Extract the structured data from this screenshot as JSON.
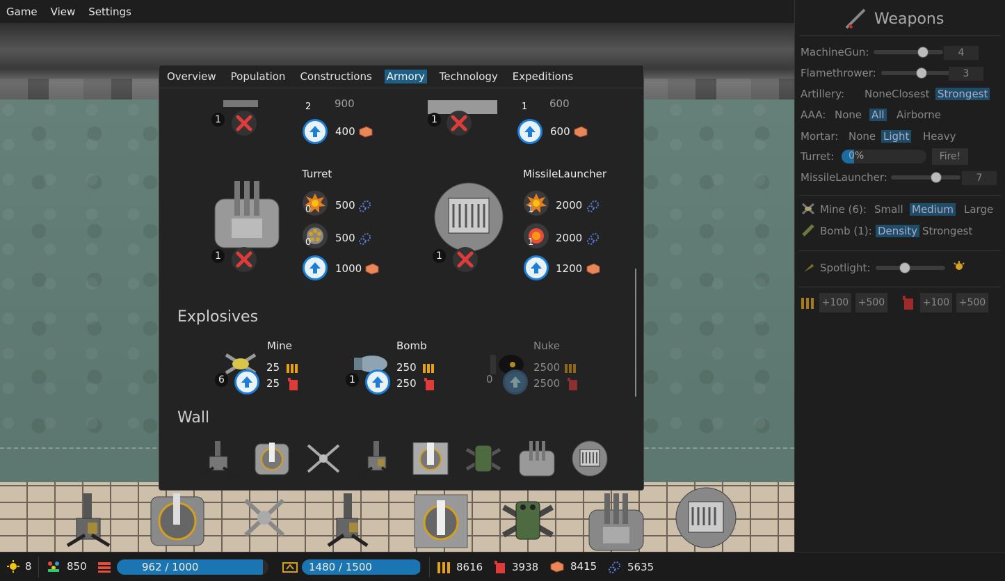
{
  "menu": [
    "Game",
    "View",
    "Settings"
  ],
  "tabs": [
    {
      "label": "Overview",
      "active": false
    },
    {
      "label": "Population",
      "active": false
    },
    {
      "label": "Constructions",
      "active": false
    },
    {
      "label": "Armory",
      "active": true
    },
    {
      "label": "Technology",
      "active": false
    },
    {
      "label": "Expeditions",
      "active": false
    }
  ],
  "armory": {
    "top_left": {
      "count": "1",
      "partial_count": "2",
      "partial_value": "900",
      "upgrade_cost": "400"
    },
    "top_right": {
      "count": "1",
      "partial_count": "1",
      "partial_value": "600",
      "upgrade_cost": "600"
    },
    "turret": {
      "name": "Turret",
      "count": "1",
      "stat1_level": "0",
      "stat1": "500",
      "stat2_level": "0",
      "stat2": "500",
      "upgrade_cost": "1000"
    },
    "missile": {
      "name": "MissileLauncher",
      "count": "1",
      "stat1_level": "1",
      "stat1": "2000",
      "stat2_level": "1",
      "stat2": "2000",
      "upgrade_cost": "1200"
    },
    "explosives_title": "Explosives",
    "mine": {
      "name": "Mine",
      "count": "6",
      "ammo": "25",
      "fuel": "25"
    },
    "bomb": {
      "name": "Bomb",
      "count": "1",
      "ammo": "250",
      "fuel": "250"
    },
    "nuke": {
      "name": "Nuke",
      "count": "0",
      "ammo": "2500",
      "fuel": "2500"
    },
    "wall_title": "Wall"
  },
  "sidebar": {
    "title": "Weapons",
    "machinegun": {
      "label": "MachineGun:",
      "value": "4",
      "level": 0.75
    },
    "flamethrower": {
      "label": "Flamethrower:",
      "value": "3",
      "level": 0.6
    },
    "artillery": {
      "label": "Artillery:",
      "options": [
        "None",
        "Closest",
        "Strongest"
      ],
      "selected": 2
    },
    "aaa": {
      "label": "AAA:",
      "options": [
        "None",
        "All",
        "Airborne"
      ],
      "selected": 1
    },
    "mortar": {
      "label": "Mortar:",
      "options": [
        "None",
        "Light",
        "Heavy"
      ],
      "selected": 1
    },
    "turret": {
      "label": "Turret:",
      "progress": "0%",
      "fire": "Fire!"
    },
    "missile": {
      "label": "MissileLauncher:",
      "value": "7",
      "level": 0.68
    },
    "mine": {
      "label": "Mine (6):",
      "options": [
        "Small",
        "Medium",
        "Large"
      ],
      "selected": 1
    },
    "bomb": {
      "label": "Bomb (1):",
      "options": [
        "Density",
        "Strongest"
      ],
      "selected": 0
    },
    "spotlight": {
      "label": "Spotlight:",
      "level": 0.4
    },
    "buy": {
      "ammo_100": "+100",
      "ammo_500": "+500",
      "fuel_100": "+100",
      "fuel_500": "+500"
    }
  },
  "status": {
    "suns": "8",
    "population": "850",
    "housing": "962 / 1000",
    "housing_level": 0.962,
    "storage": "1480 / 1500",
    "storage_level": 0.987,
    "ammo": "8616",
    "fuel": "3938",
    "bricks": "8415",
    "tech": "5635"
  },
  "colors": {
    "accent": "#1f5e85",
    "upgrade": "#1c7ed6",
    "remove": "#e03b3b",
    "brick": "#e8875a",
    "ammo": "#e6a019",
    "fuel": "#e03b3b"
  }
}
